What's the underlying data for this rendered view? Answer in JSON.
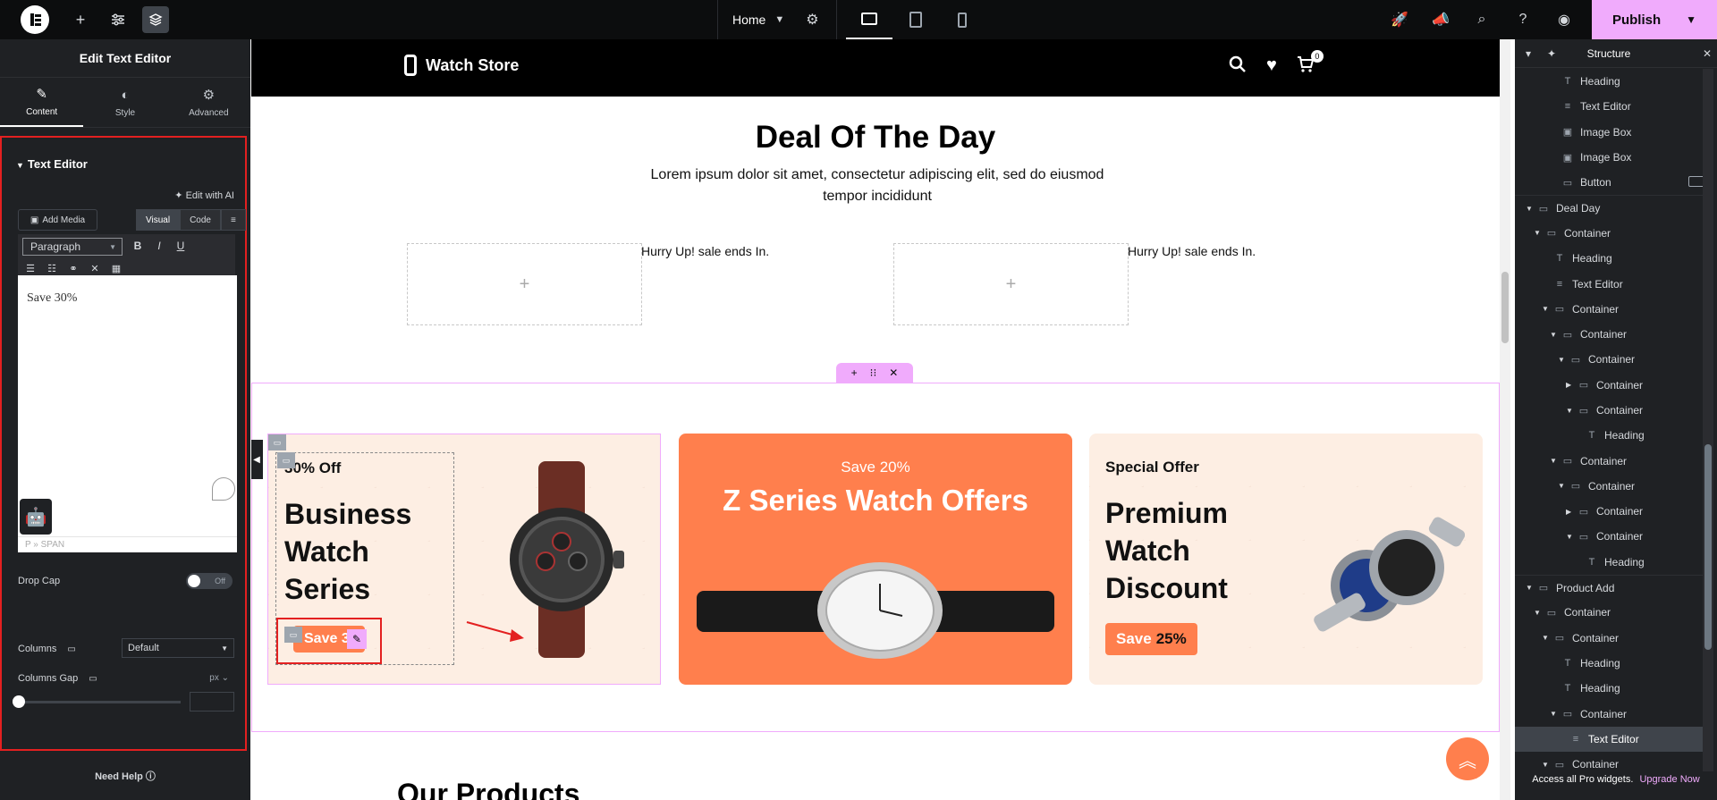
{
  "topbar": {
    "page_name": "Home",
    "publish_label": "Publish"
  },
  "left_panel": {
    "title": "Edit Text Editor",
    "tabs": [
      {
        "label": "Content",
        "icon": "pencil-icon"
      },
      {
        "label": "Style",
        "icon": "half-circle-icon"
      },
      {
        "label": "Advanced",
        "icon": "gear-icon"
      }
    ],
    "section_title": "Text Editor",
    "edit_ai_label": "Edit with AI",
    "add_media_label": "Add Media",
    "visual_tab": "Visual",
    "code_tab": "Code",
    "paragraph_select": "Paragraph",
    "editor_text": "Save 30%",
    "editor_path": "P » SPAN",
    "drop_cap_label": "Drop Cap",
    "drop_cap_state": "Off",
    "columns_label": "Columns",
    "columns_value": "Default",
    "columns_gap_label": "Columns Gap",
    "columns_gap_unit": "px",
    "need_help": "Need Help"
  },
  "canvas": {
    "brand": "Watch Store",
    "cart_count": "0",
    "deal_title": "Deal Of The Day",
    "deal_subtitle": "Lorem ipsum dolor sit amet, consectetur adipiscing elit, sed do eiusmod tempor incididunt",
    "hurry_text_1": "Hurry Up! sale ends In.",
    "hurry_text_2": "Hurry Up! sale ends In.",
    "cards": [
      {
        "small": "30% Off",
        "big": [
          "Business",
          "Watch",
          "Series"
        ],
        "button": "Save 3("
      },
      {
        "small": "Save 20%",
        "big": "Z Series Watch Offers"
      },
      {
        "small": "Special Offer",
        "big": [
          "Premium",
          "Watch",
          "Discount"
        ],
        "button_word": "Save",
        "button_pct": "25%"
      }
    ],
    "our_products": "Our Products",
    "colors": {
      "accent": "#ff7f4d",
      "card_bg": "#fdeee3",
      "editor_pink": "#f0abfc"
    }
  },
  "structure": {
    "title": "Structure",
    "items": [
      {
        "label": "Heading",
        "indent": 3,
        "icon": "T",
        "arrow": ""
      },
      {
        "label": "Text Editor",
        "indent": 3,
        "icon": "≡",
        "arrow": ""
      },
      {
        "label": "Image Box",
        "indent": 3,
        "icon": "▣",
        "arrow": ""
      },
      {
        "label": "Image Box",
        "indent": 3,
        "icon": "▣",
        "arrow": ""
      },
      {
        "label": "Button",
        "indent": 3,
        "icon": "▭",
        "arrow": ""
      },
      {
        "label": "Deal Day",
        "indent": 0,
        "icon": "▭",
        "arrow": "▼"
      },
      {
        "label": "Container",
        "indent": 1,
        "icon": "▭",
        "arrow": "▼"
      },
      {
        "label": "Heading",
        "indent": 2,
        "icon": "T",
        "arrow": ""
      },
      {
        "label": "Text Editor",
        "indent": 2,
        "icon": "≡",
        "arrow": ""
      },
      {
        "label": "Container",
        "indent": 2,
        "icon": "▭",
        "arrow": "▼"
      },
      {
        "label": "Container",
        "indent": 3,
        "icon": "▭",
        "arrow": "▼"
      },
      {
        "label": "Container",
        "indent": 4,
        "icon": "▭",
        "arrow": "▼"
      },
      {
        "label": "Container",
        "indent": 5,
        "icon": "▭",
        "arrow": "▶"
      },
      {
        "label": "Container",
        "indent": 5,
        "icon": "▭",
        "arrow": "▼"
      },
      {
        "label": "Heading",
        "indent": 6,
        "icon": "T",
        "arrow": ""
      },
      {
        "label": "Container",
        "indent": 3,
        "icon": "▭",
        "arrow": "▼"
      },
      {
        "label": "Container",
        "indent": 4,
        "icon": "▭",
        "arrow": "▼"
      },
      {
        "label": "Container",
        "indent": 5,
        "icon": "▭",
        "arrow": "▶"
      },
      {
        "label": "Container",
        "indent": 5,
        "icon": "▭",
        "arrow": "▼"
      },
      {
        "label": "Heading",
        "indent": 6,
        "icon": "T",
        "arrow": ""
      },
      {
        "label": "Product Add",
        "indent": 0,
        "icon": "▭",
        "arrow": "▼"
      },
      {
        "label": "Container",
        "indent": 1,
        "icon": "▭",
        "arrow": "▼"
      },
      {
        "label": "Container",
        "indent": 2,
        "icon": "▭",
        "arrow": "▼"
      },
      {
        "label": "Heading",
        "indent": 3,
        "icon": "T",
        "arrow": ""
      },
      {
        "label": "Heading",
        "indent": 3,
        "icon": "T",
        "arrow": ""
      },
      {
        "label": "Container",
        "indent": 3,
        "icon": "▭",
        "arrow": "▼"
      },
      {
        "label": "Text Editor",
        "indent": 4,
        "icon": "≡",
        "arrow": "",
        "selected": true
      },
      {
        "label": "Container",
        "indent": 2,
        "icon": "▭",
        "arrow": "▼"
      }
    ],
    "footer_text": "Access all Pro widgets.",
    "footer_link": "Upgrade Now"
  }
}
